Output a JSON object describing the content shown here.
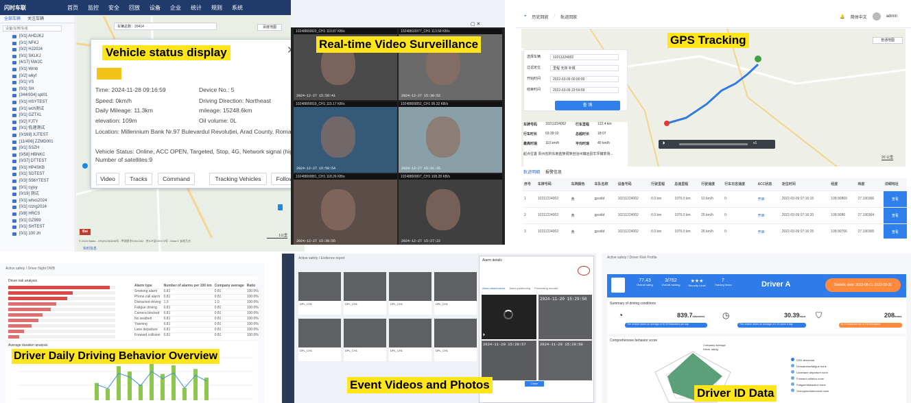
{
  "monitor": {
    "logo": "闪时车联",
    "nav": [
      {
        "icon": "home-icon",
        "label": "首页"
      },
      {
        "icon": "monitor-icon",
        "label": "监控"
      },
      {
        "icon": "shield-icon",
        "label": "安全"
      },
      {
        "icon": "replay-icon",
        "label": "回放"
      },
      {
        "icon": "device-icon",
        "label": "设备"
      },
      {
        "icon": "company-icon",
        "label": "企业"
      },
      {
        "icon": "chart-icon",
        "label": "统计"
      },
      {
        "icon": "rule-icon",
        "label": "规则"
      },
      {
        "icon": "system-icon",
        "label": "系统"
      }
    ],
    "lang": "简体中文",
    "user": "admin",
    "tree_tabs": [
      "全部车辆",
      "关注车辆"
    ],
    "tree_search_placeholder": "设备/车牌/车组",
    "vehicles": [
      "[0/1] AHDJKJ",
      "[0/1] NFKJ",
      "[0/2] HJ2024",
      "[0/1] SKLKJ",
      "[4/17] NWJC",
      "[0/1] Wmb",
      "[0/2] wkyf",
      "[0/1] VS",
      "[0/1] SH",
      "[344/934] spt01",
      "[0/1] HSYTEST",
      "[0/1] wch测试",
      "[0/1] GZTXL",
      "[0/2] FJTY",
      "[0/1] 低速测试",
      "[0/169] XJTEST",
      "[11/406] ZZMD001",
      "[0/1] SSZH",
      "[0/58] HBNKC",
      "[0/37] DTTEST",
      "[0/1] HP4SKB",
      "[0/1] SDTEST",
      "[0/3] S56YTEST",
      "[0/1] cyjsy",
      "[0/19] 测试",
      "[0/1] whxs2024",
      "[0/1] rzzrg2024",
      "[0/8] HRCS",
      "[0/1] GZ999",
      "[0/1] SHTEST",
      "[0/1] 100 zh"
    ],
    "map_toolbar": "车辆总数：20414",
    "map_type": "百度地图",
    "copyright": "© 2024 Baidu - GS(2023)3206号 - 甲测资字11111342 - 京ICP证030173号 - Data © 长地万方",
    "scale": "1公里",
    "status_tab": "实时信息",
    "popup": {
      "title": "Vehicle status display",
      "time": "Time:  2024-11-28 09:16:59",
      "device": "Device No.:  5",
      "speed": "Speed:  0km/h",
      "direction": "Driving Direction:  Northeast",
      "daily": "Daily Mileage:  11.3km",
      "mileage": "mileage:  15248.6km",
      "elevation": "elevation:  109m",
      "oil": "Oil volume:  0L",
      "location": "Location:  Millennium Bank Nr.97 Bulevardul Revoluției, Arad County, Romania",
      "status": "Vehicle Status:  Online,  ACC OPEN,  Targeted,  Stop,  4G,  Network signal (high),  Number of satellites:9",
      "buttons": [
        "Video",
        "Tracks",
        "Command",
        "Tracking Vehicles",
        "Follow"
      ]
    }
  },
  "video": {
    "title": "Real-time Video Surveillance",
    "cams": [
      "10248800820_CH1 110.87 KB/s",
      "10248810977_CH1 113.58 KB/s",
      "10248800819_CH1 115.17 KB/s",
      "10248800852_CH1 95.32 KB/s",
      "10248800881_CH1 118.26 KB/s",
      "10248800807_CH1 108.28 KB/s"
    ],
    "stamps": [
      "2024-12-27  15:58:41",
      "2024-12-27  15:30:52",
      "2024-12-27  15:58:54",
      "2024-12-27  15:31:35",
      "2024-12-27  15:30:55",
      "2024-12-27  15:27:22"
    ]
  },
  "gps": {
    "title": "GPS Tracking",
    "crumbs": [
      "历史回放",
      "轨迹回放"
    ],
    "lang": "简体中文",
    "user": "admin",
    "map_type": "普通地图",
    "form": [
      {
        "label": "选择车辆",
        "value": "10211224002"
      },
      {
        "label": "过滤定位",
        "value": "里程  无效  补报"
      },
      {
        "label": "开始时间",
        "value": "2022-03-09 00:00:00"
      },
      {
        "label": "结束时间",
        "value": "2022-03-09 23:59:59"
      }
    ],
    "query_btn": "查 询",
    "info": [
      [
        "车牌号码",
        "10211224002",
        "行车里程",
        "122.4 km"
      ],
      [
        "行车时长",
        "03:39:10",
        "总超时长",
        "18:07"
      ],
      [
        "最高时速",
        "110 km/h",
        "平均时速",
        "40 km/h"
      ]
    ],
    "addr": "起点位置  贵州省黔东南苗族侗族自治州镇远县羊坪镇茶场...",
    "speed": "x1",
    "scale": "20 公里",
    "tabs": [
      "轨迹明细",
      "报警信息"
    ],
    "columns": [
      "序号",
      "车牌号码",
      "车牌颜色",
      "车队名称",
      "设备号码",
      "行驶里程",
      "总速里程",
      "行驶速度",
      "行车日志速度",
      "ACC状态",
      "定位时间",
      "经度",
      "纬度",
      "详细地址"
    ],
    "rows": [
      [
        "1",
        "10211224002",
        "黄",
        "gpsdid",
        "10211224002",
        "0.0 km",
        "1976.0 km",
        "10 km/h",
        "0",
        "开启",
        "2022-03-09 07:16:15",
        "108.90869",
        "27.190366",
        "查看"
      ],
      [
        "2",
        "10211224002",
        "黄",
        "gpsdid",
        "10211224002",
        "0.0 km",
        "1976.0 km",
        "25 km/h",
        "0",
        "开启",
        "2022-03-09 07:16:20",
        "108.9086",
        "27.190364",
        "查看"
      ],
      [
        "3",
        "10211224002",
        "黄",
        "gpsdid",
        "10211224002",
        "0.0 km",
        "1976.0 km",
        "26 km/h",
        "0",
        "开启",
        "2022-03-09 07:16:25",
        "108.90706",
        "27.190365",
        "查看"
      ]
    ]
  },
  "behavior": {
    "title": "Driver Daily Driving Behavior Overview",
    "crumb": "Active safety / Driver Night DWB",
    "section1": "Driver risk analysis",
    "section2": "Average duration analysis",
    "columns": [
      "Alarm type",
      "Number of alarms per 100 km",
      "Company average",
      "Ratio"
    ],
    "rows": [
      [
        "Smoking alarm",
        "0.81",
        "0.81",
        "100.0%"
      ],
      [
        "Phone call alarm",
        "0.81",
        "0.81",
        "100.0%"
      ],
      [
        "Distracted driving",
        "1.0",
        "1.0",
        "100.0%"
      ],
      [
        "Fatigue driving",
        "0.81",
        "0.81",
        "100.0%"
      ],
      [
        "Camera blocked",
        "0.81",
        "0.81",
        "100.0%"
      ],
      [
        "No seatbelt",
        "0.81",
        "0.81",
        "100.0%"
      ],
      [
        "Yawning",
        "0.81",
        "0.81",
        "100.0%"
      ],
      [
        "Lane departure",
        "0.81",
        "0.81",
        "100.0%"
      ],
      [
        "Forward collision",
        "0.81",
        "0.81",
        "100.0%"
      ]
    ],
    "bar_values": [
      0.42,
      0.28,
      0.83,
      0.7,
      0.38,
      0.9,
      0.64,
      0.85,
      0.3,
      0.76,
      0.55
    ],
    "left_bars": [
      0.95,
      0.6,
      0.55,
      0.45,
      0.4,
      0.32,
      0.28,
      0.22,
      0.15,
      0.1
    ]
  },
  "events": {
    "title": "Event Videos and Photos",
    "crumb": "Active safety / Evidence report",
    "detail_title": "Alarm details",
    "stamps": [
      "2024-11-20  15:29:50",
      "2024-11-29  15:29:57",
      "2024-11-29  15:29:50"
    ],
    "cards": [
      "DPL_CH1",
      "DPL_CH1",
      "DPL_CH1",
      "DPL_CH1",
      "DPL_CH1",
      "DPL_CH1",
      "DPL_CH1",
      "DPL_CH1"
    ],
    "tabs": [
      "Alarm attachments",
      "Alarm positioning",
      "Processing records"
    ],
    "close_btn": "Close"
  },
  "driverid": {
    "title": "Driver ID Data",
    "crumb": "Active safety / Driver Risk Profile",
    "driver": "Driver A",
    "stats": "Statistic date: 2022-08-01-2022-08-31",
    "kpis": [
      {
        "v": "77.43",
        "l": "Overall rating"
      },
      {
        "v": "3/762",
        "l": "Overall ranking"
      },
      {
        "v": "★★★",
        "l": "Security Level"
      },
      {
        "v": "7",
        "l": "Training times"
      }
    ],
    "summary": "Summary of driving conditions",
    "m1": "839.7",
    "m1u": "kilometer",
    "m2": "30.39",
    "m2u": "hour",
    "m3": "208",
    "m3u": "times",
    "tag1": "The vehicle drives an average of 30.39 kilometers per day",
    "tag2": "The vehicle drives an average of 1.13 hours a day",
    "tag3": "At 13 times the risk of 100 kilometers",
    "radar_title": "Comprehensive behavior score",
    "legend": [
      "Company average",
      "Driver rating"
    ],
    "risk_list": [
      "DSS abnormal",
      "Drowsiness/fatigue  none",
      "Lane/lane departure  none",
      "Forward collision  none",
      "Fatigue/distraction  none",
      "Overspeed/abnormal  none"
    ]
  }
}
